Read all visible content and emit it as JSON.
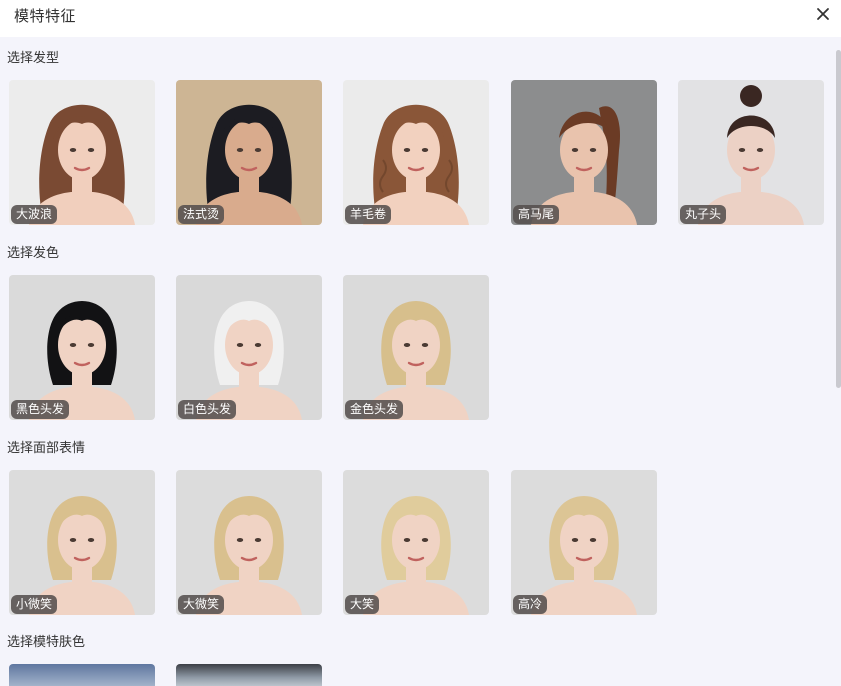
{
  "dialog": {
    "title": "模特特征"
  },
  "icons": {
    "close": "close-icon"
  },
  "sections": [
    {
      "title": "选择发型",
      "items": [
        {
          "label": "大波浪",
          "hair": "#7a4a33",
          "bg": "#ececec",
          "skin": "#f1cfbd",
          "style": "waves"
        },
        {
          "label": "法式烫",
          "hair": "#1c1c22",
          "bg": "#cdb594",
          "skin": "#d9ab8d",
          "style": "french"
        },
        {
          "label": "羊毛卷",
          "hair": "#8a5638",
          "bg": "#ebebeb",
          "skin": "#f2d1bf",
          "style": "curly"
        },
        {
          "label": "高马尾",
          "hair": "#6b3b25",
          "bg": "#8c8d8e",
          "skin": "#e9c3ad",
          "style": "ponytail"
        },
        {
          "label": "丸子头",
          "hair": "#3a2722",
          "bg": "#e2e2e4",
          "skin": "#ecd1c5",
          "style": "bun"
        }
      ]
    },
    {
      "title": "选择发色",
      "items": [
        {
          "label": "黑色头发",
          "hair": "#121214",
          "bg": "#dadada",
          "skin": "#f0d3c4",
          "style": "bob"
        },
        {
          "label": "白色头发",
          "hair": "#f0f0f0",
          "bg": "#d9d9d9",
          "skin": "#f0d3c4",
          "style": "bob"
        },
        {
          "label": "金色头发",
          "hair": "#d7bf8c",
          "bg": "#dadada",
          "skin": "#f0d3c4",
          "style": "bob"
        }
      ]
    },
    {
      "title": "选择面部表情",
      "items": [
        {
          "label": "小微笑",
          "hair": "#d9c08e",
          "bg": "#dcdcdc",
          "skin": "#f0d3c4",
          "style": "bob"
        },
        {
          "label": "大微笑",
          "hair": "#d9c08e",
          "bg": "#dcdcdc",
          "skin": "#f0d3c4",
          "style": "bob"
        },
        {
          "label": "大笑",
          "hair": "#e0cc9c",
          "bg": "#dcdcdc",
          "skin": "#f0d3c4",
          "style": "bob"
        },
        {
          "label": "高冷",
          "hair": "#dcc595",
          "bg": "#dcdcdc",
          "skin": "#f0d3c4",
          "style": "bob"
        }
      ]
    },
    {
      "title": "选择模特肤色",
      "items": []
    }
  ]
}
